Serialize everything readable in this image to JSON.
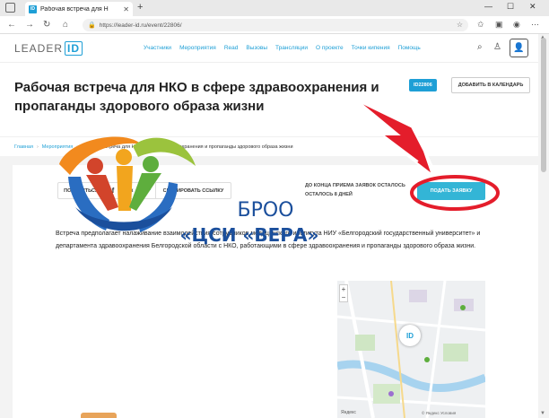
{
  "browser": {
    "tab_title": "Рабочая встреча для Н",
    "tab_favicon": "ID",
    "url": "https://leader-id.ru/event/22806/"
  },
  "header": {
    "logo_text": "LEADER",
    "logo_id": "ID",
    "nav": [
      "Участники",
      "Мероприятия",
      "Read",
      "Вызовы",
      "Трансляции",
      "О проекте",
      "Точки кипения",
      "Помощь"
    ]
  },
  "event": {
    "title": "Рабочая встреча для НКО в сфере здравоохранения и пропаганды здорового образа жизни",
    "id_badge": "ID22806",
    "calendar_button": "ДОБАВИТЬ В КАЛЕНДАРЬ"
  },
  "breadcrumb": {
    "home": "Главная",
    "events": "Мероприятия",
    "current": "Рабочая встреча для НКО в сфере здравоохранения и пропаганды здорового образа жизни"
  },
  "share": {
    "label": "ПОДЕЛИТЬСЯ",
    "facebook": "f",
    "vk": "вк",
    "copy_link": "СКОПИРОВАТЬ ССЫЛКУ"
  },
  "deadline": {
    "line1": "ДО КОНЦА ПРИЕМА ЗАЯВОК ОСТАЛОСЬ",
    "line2": "ОСТАЛОСЬ 8 ДНЕЙ"
  },
  "apply_button": "ПОДАТЬ ЗАЯВКУ",
  "description": "Встреча предполагает налаживание взаимодействия сотрудников медицинского института НИУ «Белгородский государственный университет» и департамента здравоохранения Белгородской области с НКО, работающими в сфере здравоохранения и пропаганды здорового образа жизни.",
  "org": {
    "line1": "БРОО",
    "line2": "«ЦСИ «ВЕРА»"
  },
  "map": {
    "pin_label": "ID",
    "brand": "Яндекс",
    "credit": "© Яндекс Условия"
  },
  "colors": {
    "accent": "#1e9fd6",
    "apply": "#33b5d6",
    "annotation": "#e41d2b"
  }
}
